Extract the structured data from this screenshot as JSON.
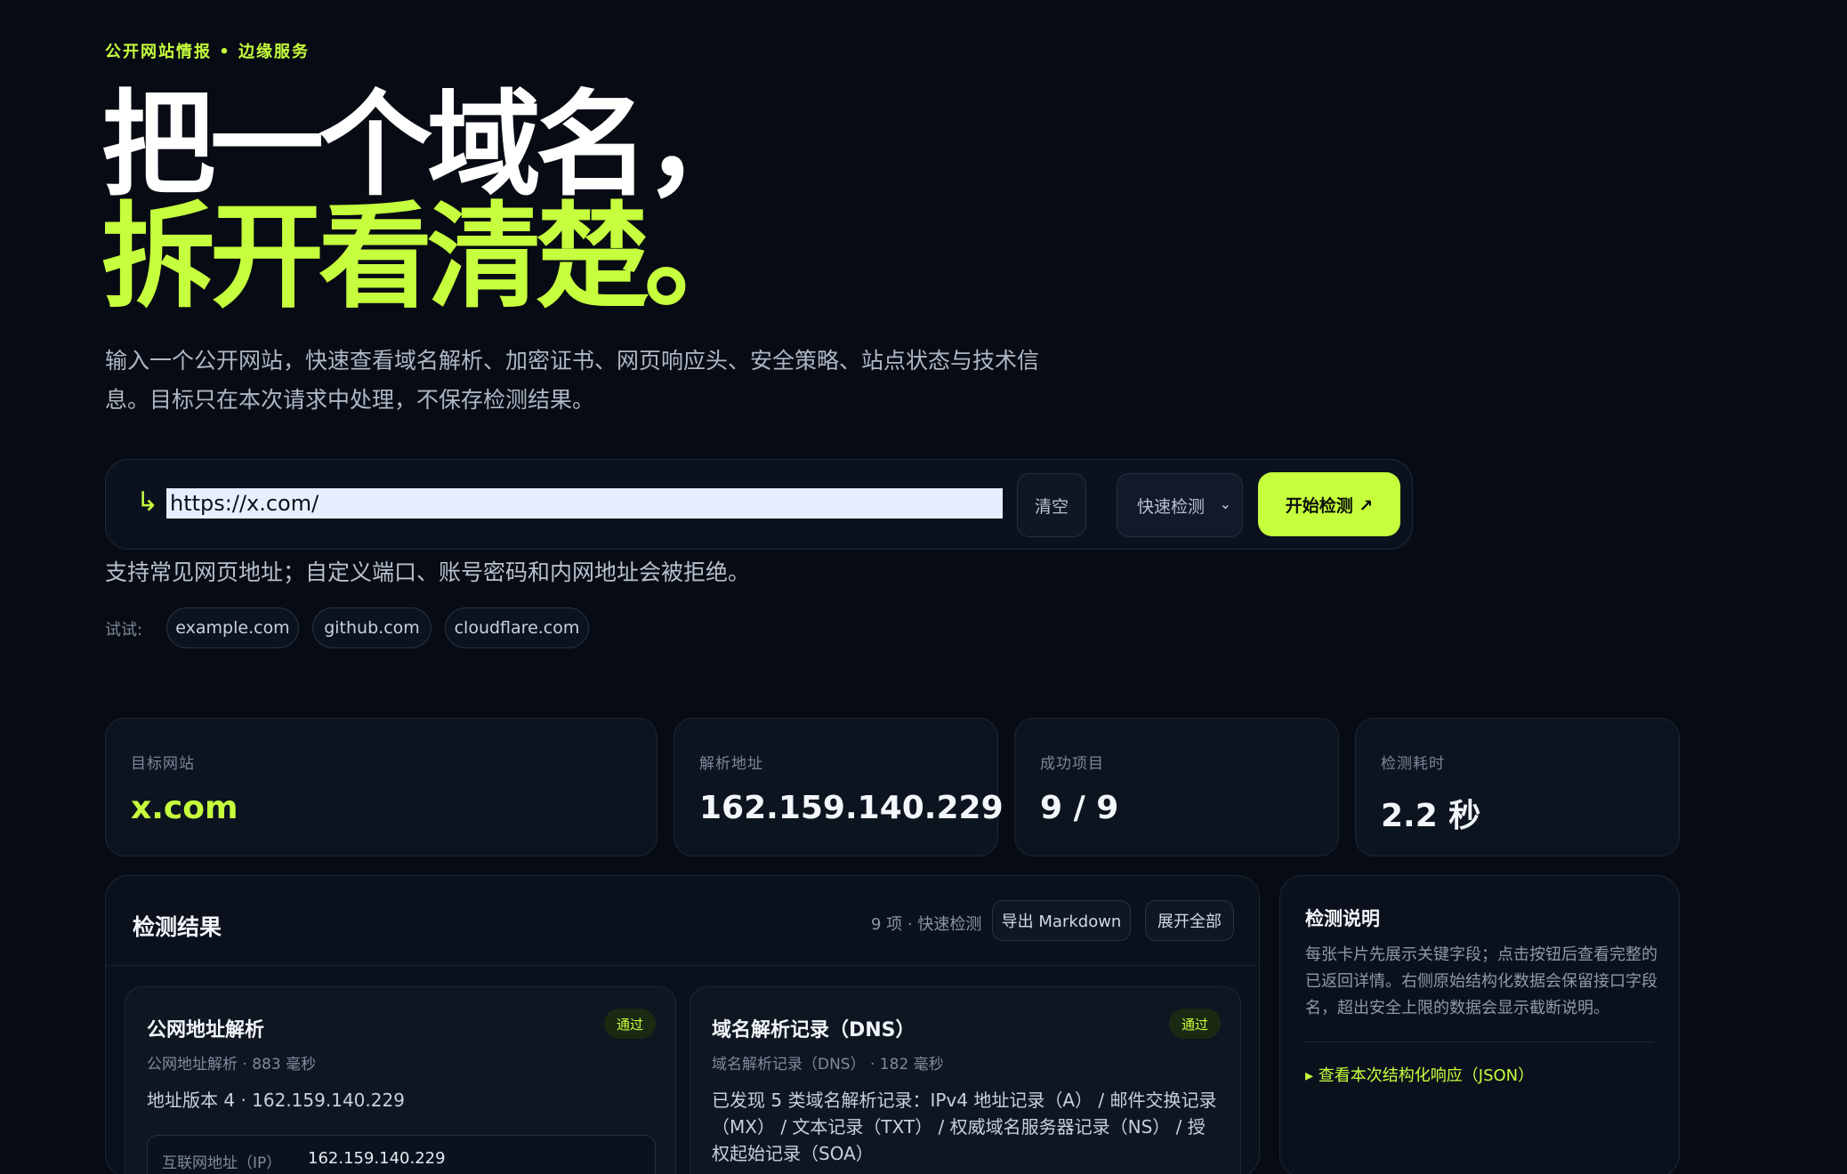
{
  "header": {
    "eyebrow": "公开网站情报 • 边缘服务",
    "hero_line1": "把一个域名，",
    "hero_line2": "拆开看清楚。",
    "description": "输入一个公开网站，快速查看域名解析、加密证书、网页响应头、安全策略、站点状态与技术信息。目标只在本次请求中处理，不保存检测结果。"
  },
  "search": {
    "arrow_icon": "↳",
    "value": "https://x.com/",
    "clear_label": "清空",
    "mode_selected": "快速检测",
    "start_label": "开始检测 ↗",
    "hint": "支持常见网页地址；自定义端口、账号密码和内网地址会被拒绝。",
    "try_label": "试试:",
    "examples": [
      "example.com",
      "github.com",
      "cloudflare.com"
    ]
  },
  "stats": [
    {
      "label": "目标网站",
      "value": "x.com"
    },
    {
      "label": "解析地址",
      "value": "162.159.140.229"
    },
    {
      "label": "成功项目",
      "value": "9 / 9"
    },
    {
      "label": "检测耗时",
      "value": "2.2 秒"
    }
  ],
  "results": {
    "title": "检测结果",
    "meta": "9 项 · 快速检测",
    "export_label": "导出 Markdown",
    "expand_label": "展开全部",
    "cards": [
      {
        "title": "公网地址解析",
        "badge": "通过",
        "sub": "公网地址解析 · 883 毫秒",
        "body": "地址版本 4 · 162.159.140.229",
        "kv_key": "互联网地址（IP）",
        "kv_value": "162.159.140.229"
      },
      {
        "title": "域名解析记录（DNS）",
        "badge": "通过",
        "sub": "域名解析记录（DNS） · 182 毫秒",
        "body": "已发现 5 类域名解析记录：IPv4 地址记录（A） / 邮件交换记录（MX） / 文本记录（TXT） / 权威域名服务器记录（NS） / 授权起始记录（SOA）"
      }
    ]
  },
  "notes": {
    "title": "检测说明",
    "text": "每张卡片先展示关键字段；点击按钮后查看完整的已返回详情。右侧原始结构化数据会保留接口字段名，超出安全上限的数据会显示截断说明。",
    "link": "▸ 查看本次结构化响应（JSON）"
  },
  "colors": {
    "accent": "#c6ff3d",
    "background": "#070b13"
  }
}
